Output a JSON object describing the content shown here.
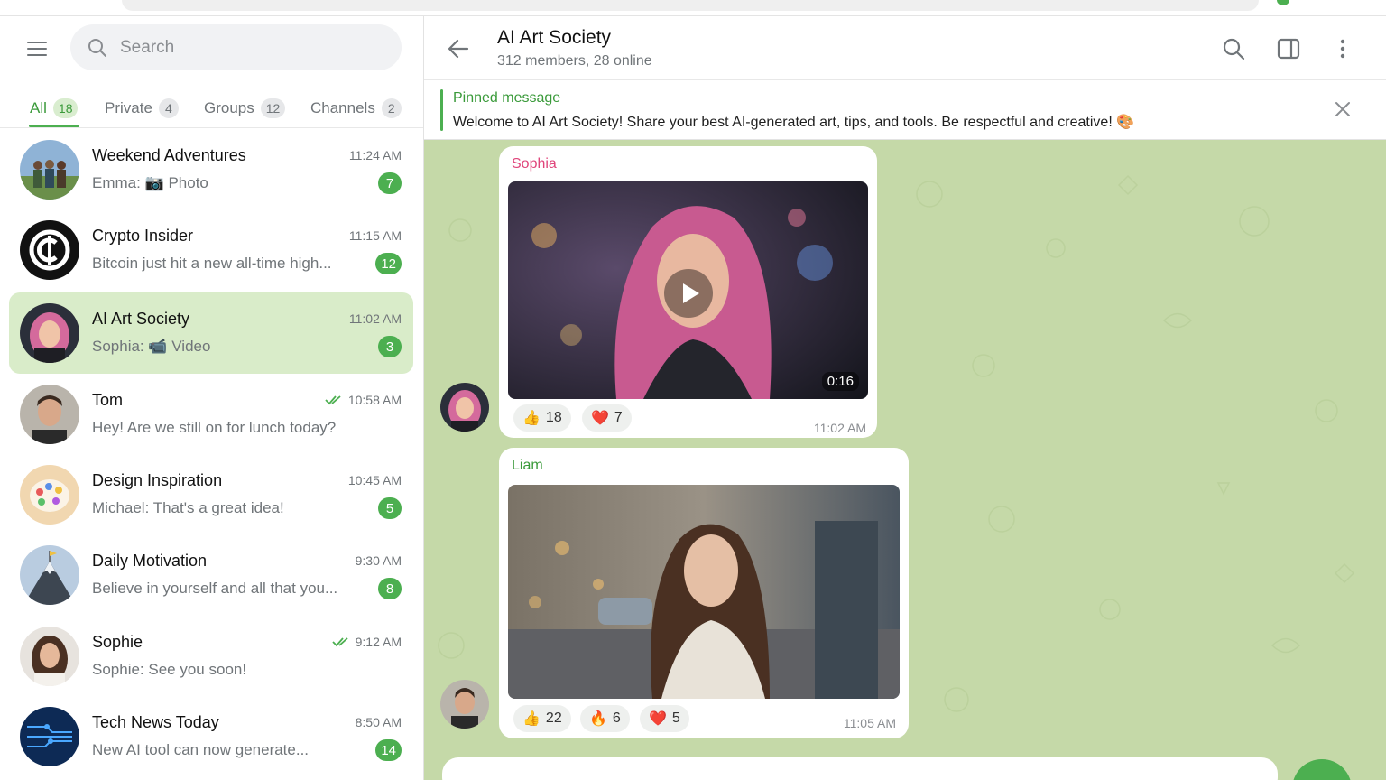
{
  "sidebar": {
    "search_placeholder": "Search",
    "tabs": [
      {
        "label": "All",
        "count": "18"
      },
      {
        "label": "Private",
        "count": "4"
      },
      {
        "label": "Groups",
        "count": "12"
      },
      {
        "label": "Channels",
        "count": "2"
      }
    ],
    "chats": [
      {
        "name": "Weekend Adventures",
        "preview": "Emma: 📷 Photo",
        "time": "11:24 AM",
        "unread": "7"
      },
      {
        "name": "Crypto Insider",
        "preview": "Bitcoin just hit a new all-time high...",
        "time": "11:15 AM",
        "unread": "12"
      },
      {
        "name": "AI Art Society",
        "preview": "Sophia: 📹 Video",
        "time": "11:02 AM",
        "unread": "3"
      },
      {
        "name": "Tom",
        "preview": "Hey! Are we still on for lunch today?",
        "time": "10:58 AM",
        "unread": ""
      },
      {
        "name": "Design Inspiration",
        "preview": "Michael: That's a great idea!",
        "time": "10:45 AM",
        "unread": "5"
      },
      {
        "name": "Daily Motivation",
        "preview": "Believe in yourself and all that you...",
        "time": "9:30 AM",
        "unread": "8"
      },
      {
        "name": "Sophie",
        "preview": "Sophie: See you soon!",
        "time": "9:12 AM",
        "unread": ""
      },
      {
        "name": "Tech News Today",
        "preview": "New AI tool can now generate...",
        "time": "8:50 AM",
        "unread": "14"
      }
    ]
  },
  "header": {
    "title": "AI Art Society",
    "subtitle": "312 members, 28 online"
  },
  "pinned": {
    "label": "Pinned message",
    "text": "Welcome to AI Art Society! Share your best AI-generated art, tips, and tools. Be respectful and creative! 🎨"
  },
  "messages": [
    {
      "sender": "Sophia",
      "duration": "0:16",
      "time": "11:02 AM",
      "reactions": [
        {
          "emoji": "👍",
          "count": "18"
        },
        {
          "emoji": "❤️",
          "count": "7"
        }
      ]
    },
    {
      "sender": "Liam",
      "time": "11:05 AM",
      "reactions": [
        {
          "emoji": "👍",
          "count": "22"
        },
        {
          "emoji": "🔥",
          "count": "6"
        },
        {
          "emoji": "❤️",
          "count": "5"
        }
      ]
    }
  ],
  "colors": {
    "accent": "#4caf50",
    "accent_text": "#3a9a3a",
    "active_chat": "#d9ecc9",
    "chat_bg": "#c5d9a8",
    "sophia_name": "#e0457b",
    "liam_name": "#3a9a3a"
  }
}
